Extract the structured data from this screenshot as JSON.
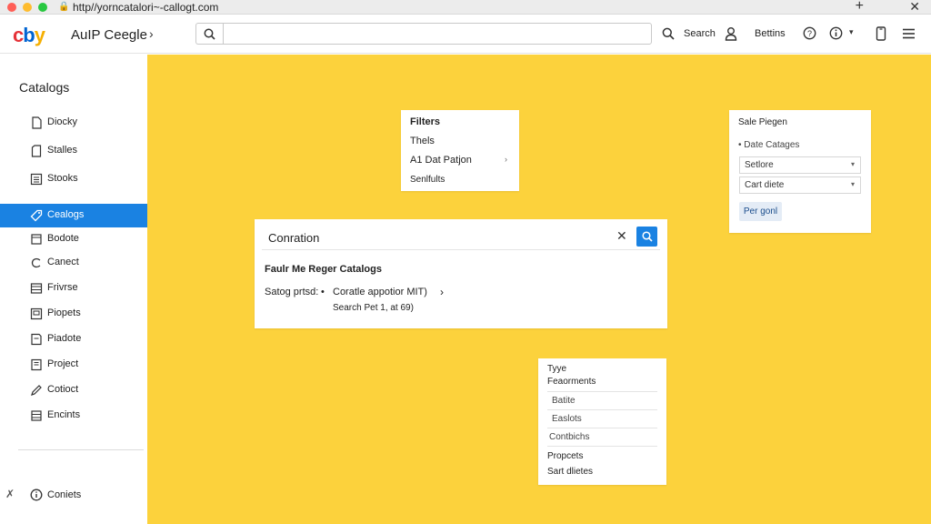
{
  "browser": {
    "url": "http//yorncatalori~-callogt.com",
    "new_tab": "+",
    "close": "✕"
  },
  "header": {
    "logo": [
      "c",
      "b",
      "y"
    ],
    "brand": "AuIP Ceegle",
    "search_placeholder": "",
    "search_label": "Search",
    "settings_label": "Bettins"
  },
  "sidebar": {
    "title": "Catalogs",
    "items": [
      {
        "label": "Diocky",
        "icon": "doc-icon"
      },
      {
        "label": "Stalles",
        "icon": "file-icon"
      },
      {
        "label": "Stooks",
        "icon": "list-icon"
      },
      {
        "label": "Cealogs",
        "icon": "tag-icon",
        "active": true
      },
      {
        "label": "Bodote",
        "icon": "box-icon"
      },
      {
        "label": "Canect",
        "icon": "link-icon"
      },
      {
        "label": "Frivrse",
        "icon": "grid-icon"
      },
      {
        "label": "Piopets",
        "icon": "page-icon"
      },
      {
        "label": "Piadote",
        "icon": "note-icon"
      },
      {
        "label": "Project",
        "icon": "folder-icon"
      },
      {
        "label": "Cotioct",
        "icon": "pen-icon"
      },
      {
        "label": "Encints",
        "icon": "stack-icon"
      }
    ],
    "bottom_label": "Coniets"
  },
  "filters_panel": {
    "title": "Filters",
    "item1": "Thels",
    "item2": "A1 Dat Patjon",
    "link": "Senlfults"
  },
  "sale_panel": {
    "title": "Sale Piegen",
    "subtitle": "• Date Catages",
    "select1": "Setlore",
    "select2": "Cart diete",
    "button": "Per gonl"
  },
  "search_panel": {
    "query": "Conration",
    "heading": "Faulr Me Reger Catalogs",
    "result_prefix": "Satog prtsd:",
    "result_link": "Coratle appotior MIT)",
    "result_meta": "Search Pet 1,  at 69)"
  },
  "type_panel": {
    "title": "Tyye",
    "subtitle": "Feaorments",
    "rows": [
      "Batite",
      "Easlots",
      "Contbichs"
    ],
    "section": "Propcets",
    "link": "Sart dlietes"
  },
  "colors": {
    "main_bg": "#fcd23c",
    "accent": "#1a82e2",
    "link": "#1a6fc4"
  }
}
